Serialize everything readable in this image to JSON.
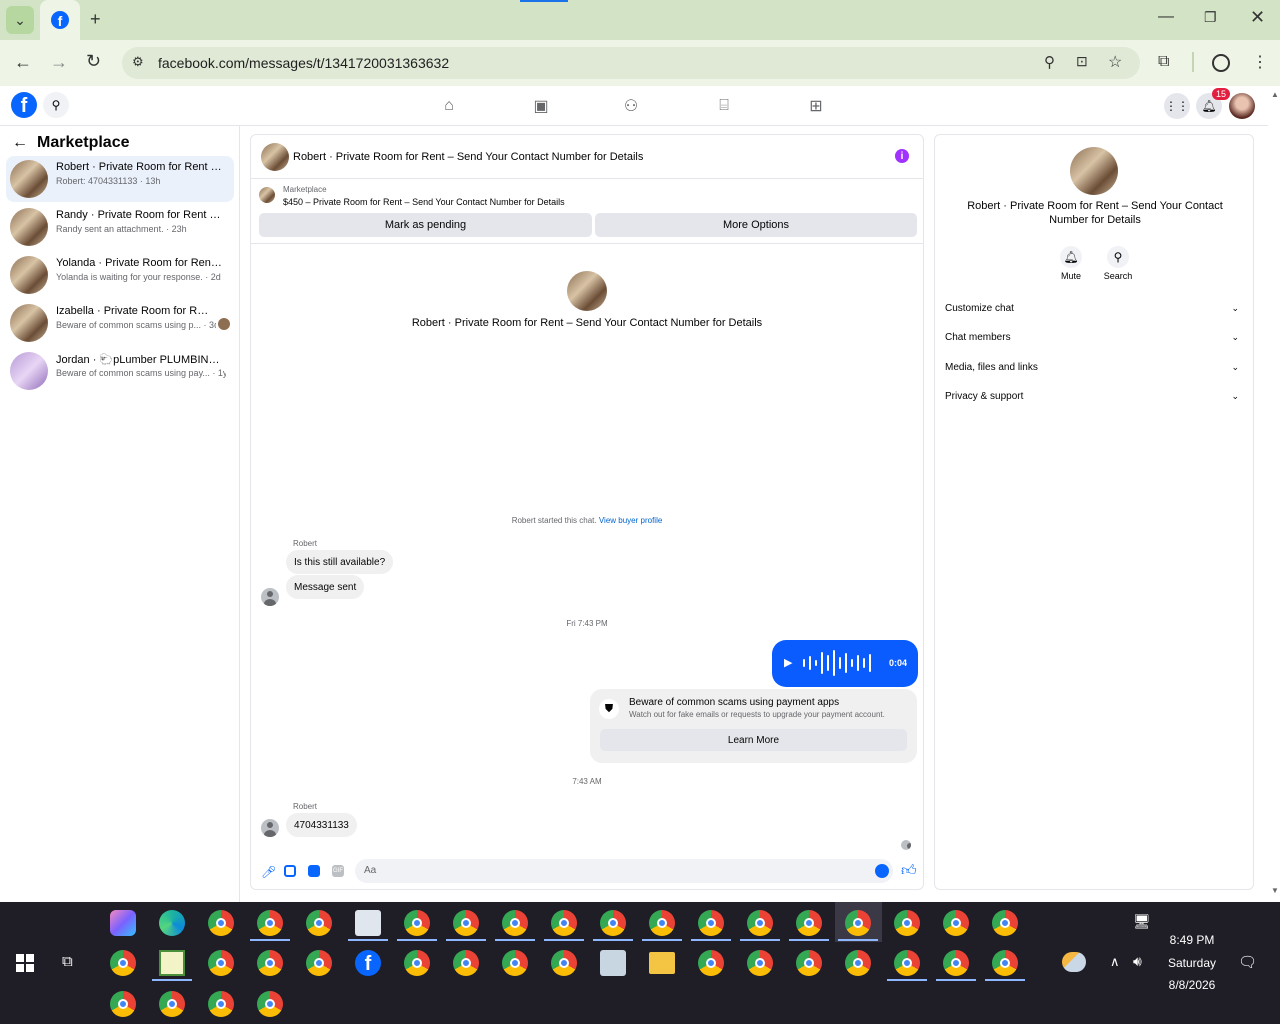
{
  "browser": {
    "url": "facebook.com/messages/t/1341720031363632",
    "tab_icon": "facebook-icon"
  },
  "fb_header": {
    "notification_count": "15"
  },
  "left": {
    "title": "Marketplace",
    "conversations": [
      {
        "name": "Robert · Private Room for Rent – S...",
        "sub": "Robert: 4704331133 · 13h"
      },
      {
        "name": "Randy · Private Room for Rent – S...",
        "sub": "Randy sent an attachment. · 23h"
      },
      {
        "name": "Yolanda · Private Room for Rent – ...",
        "sub": "Yolanda is waiting for your response. · 2d"
      },
      {
        "name": "Izabella · Private Room for Rent ...",
        "sub": "Beware of common scams using p... · 3d"
      },
      {
        "name": "Jordan · 🐑pLumber PLUMBING, p...",
        "sub": "Beware of common scams using pay... · 1y"
      }
    ]
  },
  "chat": {
    "title": "Robert · Private Room for Rent – Send Your Contact Number for Details",
    "listing_label": "Marketplace",
    "listing_text": "$450 – Private Room for Rent – Send Your Contact Number for Details",
    "mark_pending": "Mark as pending",
    "more_options": "More Options",
    "center_title": "Robert · Private Room for Rent – Send Your Contact Number for Details",
    "started_text": "Robert started this chat.",
    "view_buyer": "View buyer profile",
    "sender_1": "Robert",
    "msg_1": "Is this still available?",
    "msg_2": "Message sent",
    "time_1": "Fri 7:43 PM",
    "audio_duration": "0:04",
    "scam_title": "Beware of common scams using payment apps",
    "scam_body": "Watch out for fake emails or requests to upgrade your payment account.",
    "learn_more": "Learn More",
    "time_2": "7:43 AM",
    "sender_2": "Robert",
    "msg_3": "4704331133",
    "composer_placeholder": "Aa"
  },
  "right": {
    "title": "Robert · Private Room for Rent – Send Your Contact Number for Details",
    "mute": "Mute",
    "search": "Search",
    "sections": [
      "Customize chat",
      "Chat members",
      "Media, files and links",
      "Privacy & support"
    ]
  },
  "taskbar": {
    "time": "8:49 PM",
    "day": "Saturday",
    "date": "8/8/2026"
  }
}
